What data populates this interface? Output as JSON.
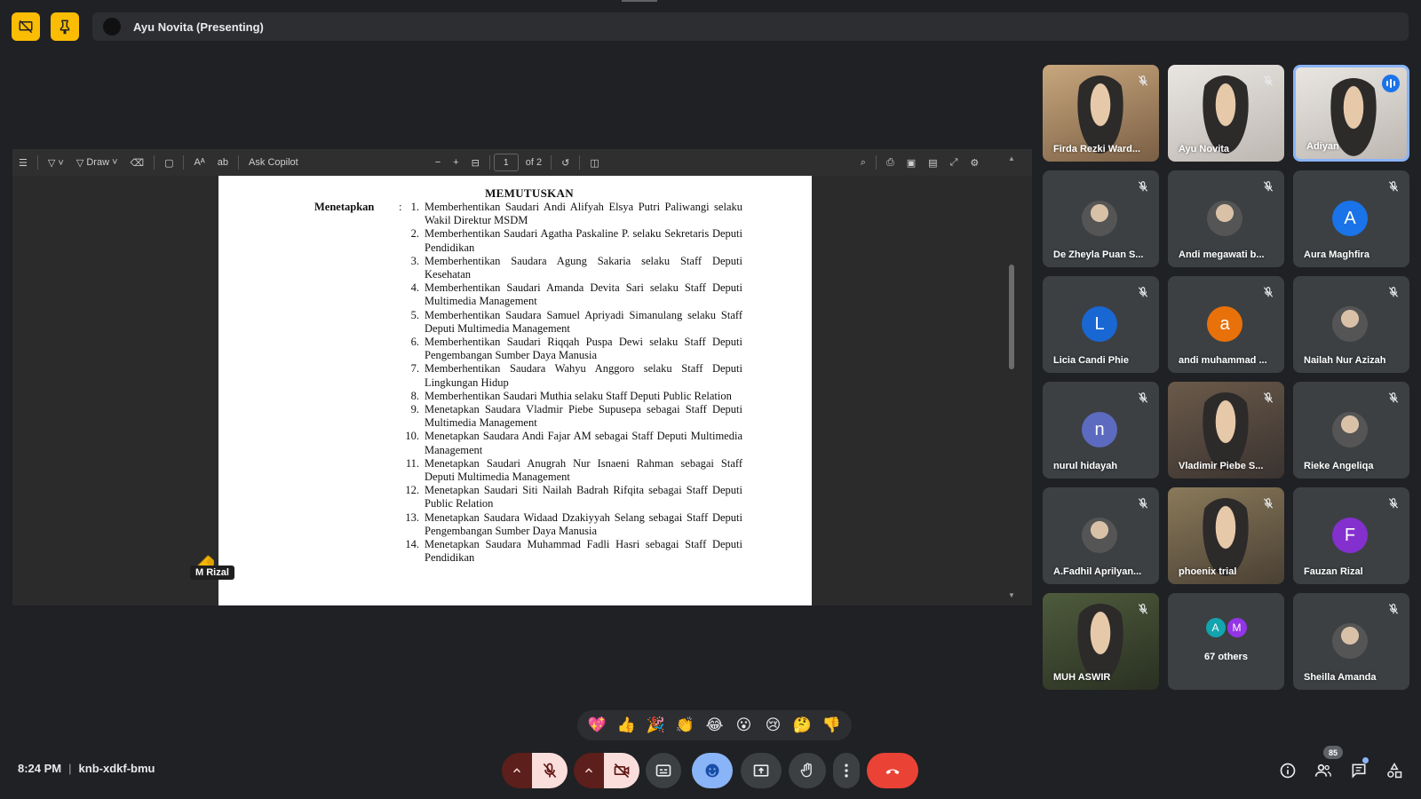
{
  "presenter": {
    "label": "Ayu Novita (Presenting)"
  },
  "pdf_toolbar": {
    "draw_label": "Draw",
    "ask_copilot_label": "Ask Copilot",
    "page_current": "1",
    "page_total": "of 2"
  },
  "document": {
    "heading": "MEMUTUSKAN",
    "label": "Menetapkan",
    "colon": ":",
    "items": [
      {
        "num": "1.",
        "text": "Memberhentikan Saudari Andi Alifyah Elsya Putri Paliwangi selaku Wakil Direktur MSDM"
      },
      {
        "num": "2.",
        "text": "Memberhentikan Saudari Agatha Paskaline P. selaku Sekretaris Deputi Pendidikan"
      },
      {
        "num": "3.",
        "text": "Memberhentikan Saudara Agung Sakaria selaku Staff Deputi Kesehatan"
      },
      {
        "num": "4.",
        "text": "Memberhentikan Saudari Amanda Devita Sari selaku Staff Deputi Multimedia Management"
      },
      {
        "num": "5.",
        "text": "Memberhentikan Saudara Samuel Apriyadi Simanulang selaku Staff Deputi Multimedia Management"
      },
      {
        "num": "6.",
        "text": "Memberhentikan Saudari Riqqah Puspa Dewi selaku Staff Deputi Pengembangan Sumber Daya Manusia"
      },
      {
        "num": "7.",
        "text": "Memberhentikan Saudara Wahyu Anggoro selaku Staff Deputi Lingkungan Hidup"
      },
      {
        "num": "8.",
        "text": "Memberhentikan Saudari Muthia selaku Staff Deputi Public Relation"
      },
      {
        "num": "9.",
        "text": "Menetapkan Saudara Vladmir Piebe Supusepa sebagai Staff Deputi Multimedia Management"
      },
      {
        "num": "10.",
        "text": "Menetapkan Saudara Andi Fajar AM sebagai Staff Deputi Multimedia Management"
      },
      {
        "num": "11.",
        "text": "Menetapkan Saudari Anugrah Nur Isnaeni Rahman sebagai Staff Deputi Multimedia Management"
      },
      {
        "num": "12.",
        "text": "Menetapkan Saudari Siti Nailah Badrah Rifqita sebagai Staff Deputi Public Relation"
      },
      {
        "num": "13.",
        "text": "Menetapkan Saudara Widaad Dzakiyyah Selang sebagai Staff Deputi Pengembangan Sumber Daya Manusia"
      },
      {
        "num": "14.",
        "text": "Menetapkan Saudara Muhammad Fadli Hasri sebagai Staff Deputi Pendidikan"
      }
    ]
  },
  "cursor_label": "M Rizal",
  "participants": [
    {
      "name": "Firda Rezki Ward...",
      "kind": "video",
      "tone": "warm",
      "muted": true
    },
    {
      "name": "Ayu Novita",
      "kind": "video",
      "tone": "white",
      "muted": true
    },
    {
      "name": "Adiyan",
      "kind": "video",
      "tone": "white",
      "speaking": true
    },
    {
      "name": "De Zheyla Puan S...",
      "kind": "photo",
      "muted": true
    },
    {
      "name": "Andi megawati b...",
      "kind": "photo",
      "muted": true
    },
    {
      "name": "Aura Maghfira",
      "kind": "letter",
      "letter": "A",
      "color": "#1a73e8",
      "muted": true
    },
    {
      "name": "Licia Candi Phie",
      "kind": "letter",
      "letter": "L",
      "color": "#1967d2",
      "muted": true
    },
    {
      "name": "andi muhammad ...",
      "kind": "letter",
      "letter": "a",
      "color": "#e8710a",
      "muted": true
    },
    {
      "name": "Nailah Nur Azizah",
      "kind": "photo",
      "muted": true
    },
    {
      "name": "nurul hidayah",
      "kind": "letter",
      "letter": "n",
      "color": "#5c6bc0",
      "muted": true
    },
    {
      "name": "Vladimir Piebe S...",
      "kind": "video",
      "tone": "video",
      "muted": true
    },
    {
      "name": "Rieke Angeliqa",
      "kind": "photo",
      "muted": true
    },
    {
      "name": "A.Fadhil Aprilyan...",
      "kind": "photo",
      "muted": true
    },
    {
      "name": "phoenix trial",
      "kind": "video",
      "tone": "room",
      "muted": true
    },
    {
      "name": "Fauzan Rizal",
      "kind": "letter",
      "letter": "F",
      "color": "#8430ce",
      "muted": true
    },
    {
      "name": "MUH ASWIR",
      "kind": "video",
      "tone": "green",
      "muted": true
    },
    {
      "name": "67 others",
      "kind": "others",
      "letters": [
        "A",
        "M"
      ],
      "colors": [
        "#12a4af",
        "#9334e6"
      ]
    },
    {
      "name": "Sheilla Amanda",
      "kind": "photo",
      "muted": true
    }
  ],
  "reactions": [
    "💖",
    "👍",
    "🎉",
    "👏",
    "😂",
    "😮",
    "😢",
    "🤔",
    "👎"
  ],
  "bottom": {
    "time": "8:24 PM",
    "separator": "|",
    "meeting_code": "knb-xdkf-bmu",
    "people_count": "85"
  },
  "colors": {
    "background": "#202124",
    "end_call": "#ea4335",
    "mic_off_bg": "#f9dedc",
    "accent": "#8ab4f8"
  }
}
